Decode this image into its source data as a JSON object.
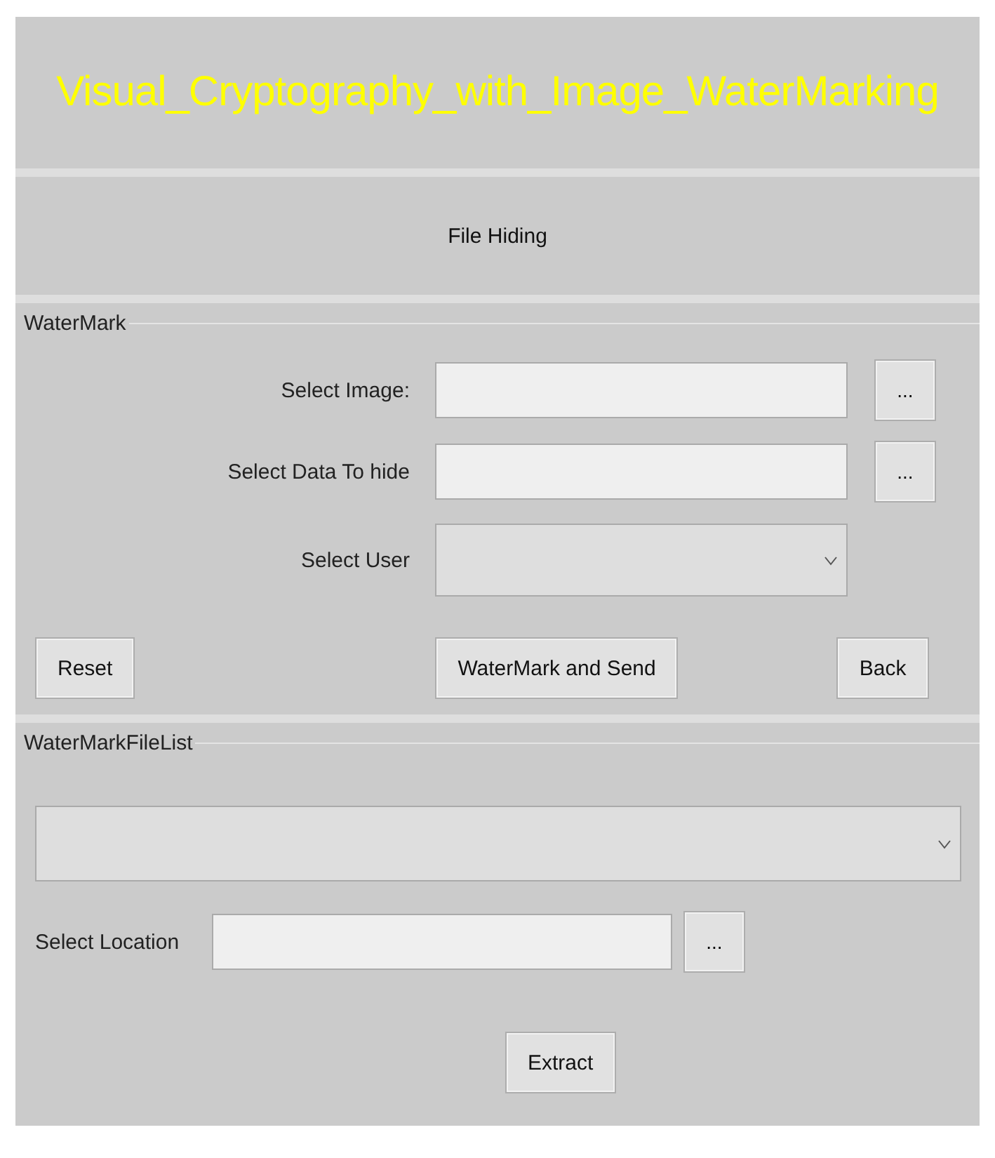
{
  "title": "Visual_Cryptography_with_Image_WaterMarking",
  "subtitle": "File Hiding",
  "watermark_group": {
    "label": "WaterMark",
    "fields": [
      {
        "kind": "text",
        "label": "Select Image:",
        "browse": "..."
      },
      {
        "kind": "text",
        "label": "Select Data To hide",
        "browse": "..."
      },
      {
        "kind": "dropdown",
        "label": "Select User"
      }
    ],
    "buttons": [
      "Reset",
      "WaterMark and Send",
      "Back"
    ]
  },
  "file_list_group": {
    "label": "WaterMarkFileList",
    "location_label": "Select Location",
    "browse": "...",
    "extract_button": "Extract"
  }
}
